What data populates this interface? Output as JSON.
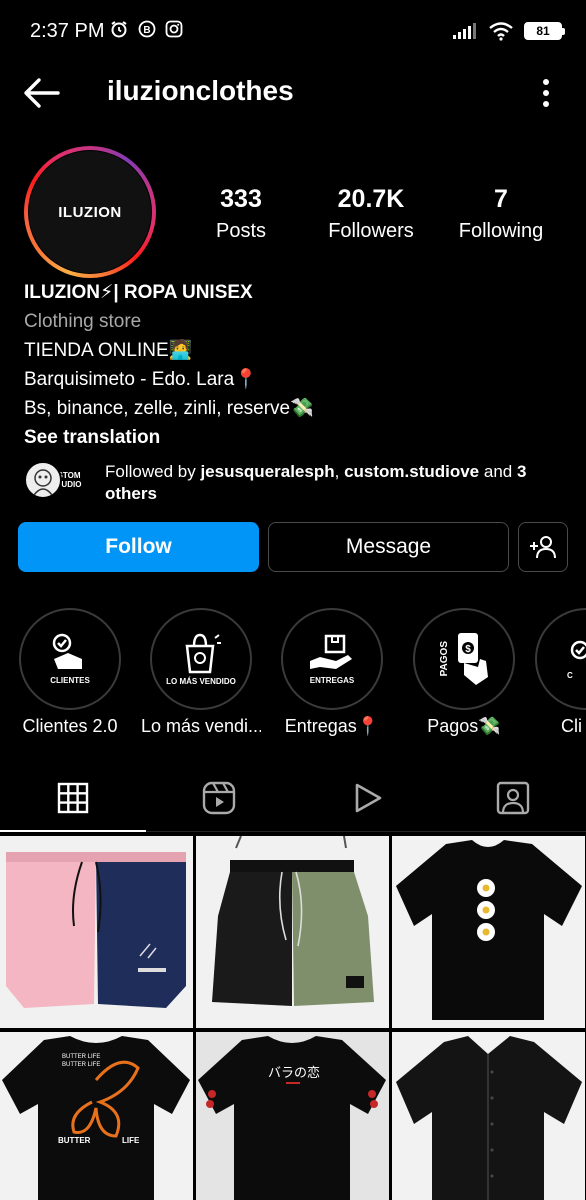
{
  "status_bar": {
    "time": "2:37 PM",
    "battery": "81"
  },
  "header": {
    "username": "iluzionclothes"
  },
  "profile": {
    "avatar_text": "ILUZION",
    "stats": [
      {
        "value": "333",
        "label": "Posts"
      },
      {
        "value": "20.7K",
        "label": "Followers"
      },
      {
        "value": "7",
        "label": "Following"
      }
    ],
    "bio": {
      "name": "ILUZION⚡| ROPA UNISEX",
      "category": "Clothing store",
      "line1": "TIENDA ONLINE🧑‍💻",
      "line2": "Barquisimeto - Edo. Lara📍",
      "line3": "Bs, binance, zelle, zinli, reserve💸",
      "see_translation": "See translation"
    },
    "followed_by": {
      "prefix": "Followed by ",
      "user1": "jesusqueralesph",
      "separator": ", ",
      "user2": "custom.studiove",
      "middle": " and ",
      "others": "3 others",
      "mini_logo": "STOM TUDIO"
    }
  },
  "actions": {
    "follow": "Follow",
    "message": "Message"
  },
  "highlights": [
    {
      "label": "Clientes 2.0",
      "cover_text": "CLIENTES"
    },
    {
      "label": "Lo más vendi...",
      "cover_text": "LO MÁS VENDIDO"
    },
    {
      "label": "Entregas📍",
      "cover_text": "ENTREGAS"
    },
    {
      "label": "Pagos💸",
      "cover_text": "PAGOS"
    },
    {
      "label": "Cli",
      "cover_text": "C"
    }
  ],
  "posts": [
    {
      "print": ""
    },
    {
      "print": ""
    },
    {
      "print": ""
    },
    {
      "print": "BUTTER LIFE",
      "print_a": "BUTTER",
      "print_b": "LIFE"
    },
    {
      "print": "バラの恋"
    },
    {
      "print": ""
    }
  ],
  "colors": {
    "follow_blue": "#0095f6",
    "background": "#000000",
    "secondary_text": "#a8a8a8"
  }
}
